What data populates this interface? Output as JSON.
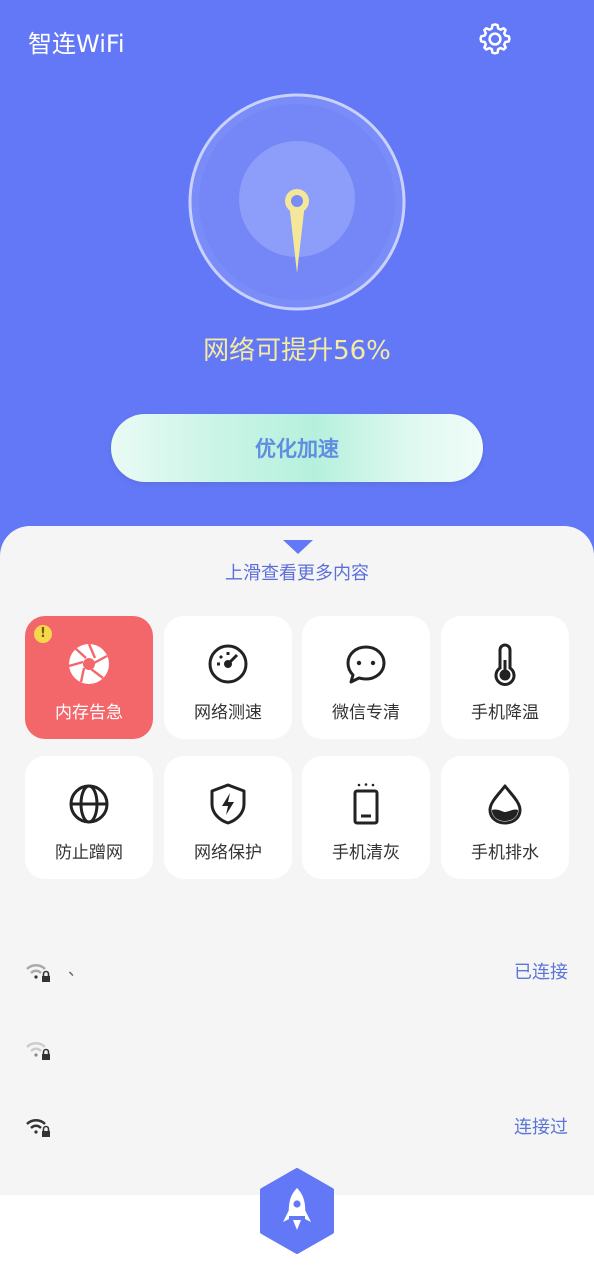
{
  "header": {
    "app_title": "智连WiFi",
    "settings_icon": "gear-icon"
  },
  "hero": {
    "dial_icon": "needle-pointer-icon",
    "boost_text": "网络可提升56%"
  },
  "optimize_button": {
    "label": "优化加速"
  },
  "sheet": {
    "swipe_hint": "上滑查看更多内容"
  },
  "tools": [
    {
      "label": "内存告急",
      "icon": "aperture-icon",
      "alert": true
    },
    {
      "label": "网络测速",
      "icon": "speedometer-icon"
    },
    {
      "label": "微信专清",
      "icon": "chat-bubble-icon"
    },
    {
      "label": "手机降温",
      "icon": "thermometer-icon"
    },
    {
      "label": "防止蹭网",
      "icon": "globe-icon"
    },
    {
      "label": "网络保护",
      "icon": "shield-bolt-icon"
    },
    {
      "label": "手机清灰",
      "icon": "phone-dust-icon"
    },
    {
      "label": "手机排水",
      "icon": "water-drop-icon"
    }
  ],
  "wifi_list": [
    {
      "name": "、",
      "status": "已连接"
    },
    {
      "name": "",
      "status": ""
    },
    {
      "name": "",
      "status": "连接过"
    },
    {
      "name": "",
      "status": ""
    }
  ],
  "nav": {
    "rocket_icon": "rocket-icon"
  },
  "colors": {
    "primary": "#6378f6",
    "alert": "#f3676b",
    "accent_text": "#5c76d6",
    "highlight_text": "#f5eba0"
  }
}
